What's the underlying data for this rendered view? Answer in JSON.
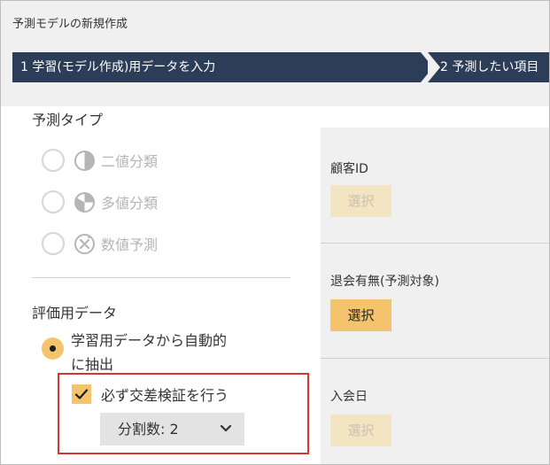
{
  "window": {
    "title": "予測モデルの新規作成"
  },
  "steps": [
    {
      "label": "1 学習(モデル作成)用データを入力"
    },
    {
      "label": "2 予測したい項目"
    }
  ],
  "prediction_type": {
    "title": "予測タイプ",
    "options": [
      {
        "label": "二値分類",
        "icon": "half-circle-icon",
        "selected": false
      },
      {
        "label": "多値分類",
        "icon": "pie-icon",
        "selected": false
      },
      {
        "label": "数値予測",
        "icon": "x-circle-icon",
        "selected": false
      }
    ]
  },
  "evaluation": {
    "title": "評価用データ",
    "auto_label_line1": "学習用データから自動的",
    "auto_label_line2": "に抽出",
    "auto_selected": true,
    "cross_validation": {
      "label": "必ず交差検証を行う",
      "checked": true,
      "split_label": "分割数: 2"
    }
  },
  "fields": [
    {
      "label": "顧客ID",
      "button": "選択",
      "state": "disabled"
    },
    {
      "label": "退会有無(予測対象)",
      "button": "選択",
      "state": "active"
    },
    {
      "label": "入会日",
      "button": "選択",
      "state": "disabled"
    }
  ],
  "colors": {
    "step_bg": "#2c3e57",
    "accent": "#f5c36b",
    "highlight_border": "#d83434",
    "panel_bg": "#f0f0f0"
  }
}
